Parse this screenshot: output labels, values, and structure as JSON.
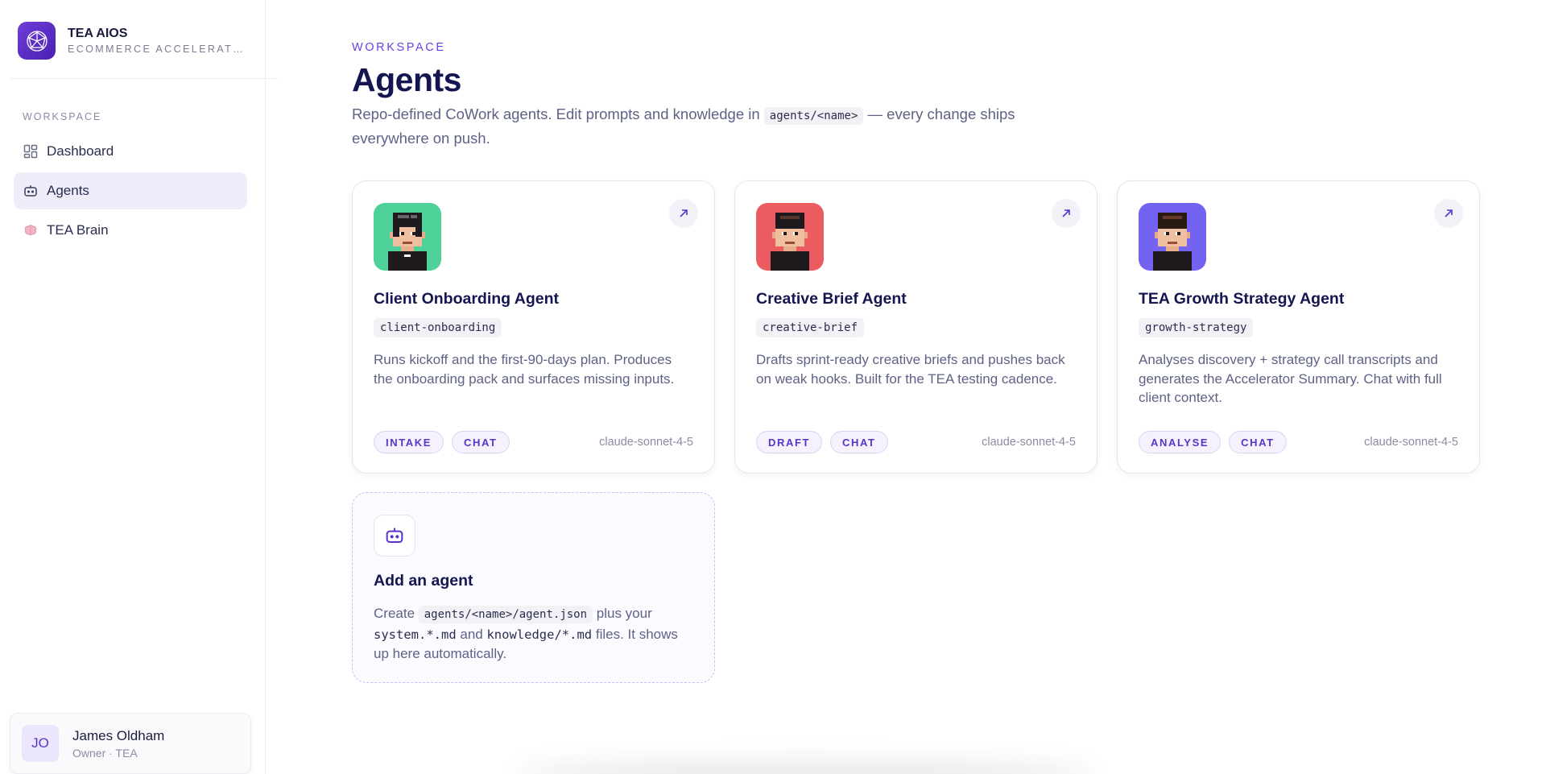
{
  "brand": {
    "name": "TEA AIOS",
    "subtitle": "ECOMMERCE ACCELERAT…"
  },
  "sidebar": {
    "section_label": "WORKSPACE",
    "items": [
      {
        "label": "Dashboard",
        "icon": "grid-icon"
      },
      {
        "label": "Agents",
        "icon": "robot-icon",
        "active": true
      },
      {
        "label": "TEA Brain",
        "icon": "brain-icon"
      }
    ]
  },
  "user": {
    "initials": "JO",
    "name": "James Oldham",
    "role": "Owner · TEA"
  },
  "main": {
    "eyebrow": "WORKSPACE",
    "title": "Agents",
    "desc_before": "Repo-defined CoWork agents. Edit prompts and knowledge in ",
    "desc_code": "agents/<name>",
    "desc_after": " — every change ships everywhere on push."
  },
  "agents": [
    {
      "title": "Client Onboarding Agent",
      "slug": "client-onboarding",
      "description": "Runs kickoff and the first-90-days plan. Produces the onboarding pack and surfaces missing inputs.",
      "tags": [
        "INTAKE",
        "CHAT"
      ],
      "model": "claude-sonnet-4-5",
      "avatar_bg": "#4fd19a"
    },
    {
      "title": "Creative Brief Agent",
      "slug": "creative-brief",
      "description": "Drafts sprint-ready creative briefs and pushes back on weak hooks. Built for the TEA testing cadence.",
      "tags": [
        "DRAFT",
        "CHAT"
      ],
      "model": "claude-sonnet-4-5",
      "avatar_bg": "#ec5b5f"
    },
    {
      "title": "TEA Growth Strategy Agent",
      "slug": "growth-strategy",
      "description": "Analyses discovery + strategy call transcripts and generates the Accelerator Summary. Chat with full client context.",
      "tags": [
        "ANALYSE",
        "CHAT"
      ],
      "model": "claude-sonnet-4-5",
      "avatar_bg": "#7462f0"
    }
  ],
  "add_agent": {
    "title": "Add an agent",
    "text_1": "Create ",
    "code_1": "agents/<name>/agent.json",
    "text_2": " plus your ",
    "code_2": "system.*.md",
    "text_3": " and ",
    "code_3": "knowledge/*.md",
    "text_4": " files. It shows up here automatically."
  },
  "colors": {
    "accent": "#6b3fe0",
    "title": "#131650",
    "muted": "#5e6285"
  }
}
